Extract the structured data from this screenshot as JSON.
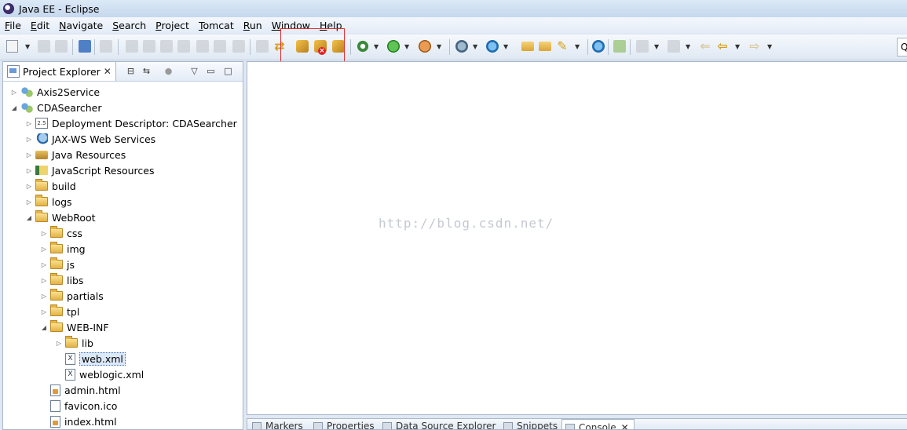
{
  "window": {
    "title": "Java EE - Eclipse"
  },
  "menu": [
    "File",
    "Edit",
    "Navigate",
    "Search",
    "Project",
    "Tomcat",
    "Run",
    "Window",
    "Help"
  ],
  "toolbar": {
    "highlighted_group": [
      "start-tomcat-icon",
      "stop-tomcat-icon",
      "restart-tomcat-icon"
    ],
    "quick_access_text": "Q"
  },
  "explorer": {
    "title": "Project Explorer",
    "close_glyph": "✕",
    "tree": [
      {
        "label": "Axis2Service",
        "depth": 0,
        "expander": "▷",
        "icon": "project"
      },
      {
        "label": "CDASearcher",
        "depth": 0,
        "expander": "◢",
        "icon": "project"
      },
      {
        "label": "Deployment Descriptor: CDASearcher",
        "depth": 1,
        "expander": "▷",
        "icon": "desc"
      },
      {
        "label": "JAX-WS Web Services",
        "depth": 1,
        "expander": "▷",
        "icon": "ws"
      },
      {
        "label": "Java Resources",
        "depth": 1,
        "expander": "▷",
        "icon": "jres"
      },
      {
        "label": "JavaScript Resources",
        "depth": 1,
        "expander": "▷",
        "icon": "jsres"
      },
      {
        "label": "build",
        "depth": 1,
        "expander": "▷",
        "icon": "folder"
      },
      {
        "label": "logs",
        "depth": 1,
        "expander": "▷",
        "icon": "folder"
      },
      {
        "label": "WebRoot",
        "depth": 1,
        "expander": "◢",
        "icon": "folder"
      },
      {
        "label": "css",
        "depth": 2,
        "expander": "▷",
        "icon": "folder"
      },
      {
        "label": "img",
        "depth": 2,
        "expander": "▷",
        "icon": "folder"
      },
      {
        "label": "js",
        "depth": 2,
        "expander": "▷",
        "icon": "folder"
      },
      {
        "label": "libs",
        "depth": 2,
        "expander": "▷",
        "icon": "folder"
      },
      {
        "label": "partials",
        "depth": 2,
        "expander": "▷",
        "icon": "folder"
      },
      {
        "label": "tpl",
        "depth": 2,
        "expander": "▷",
        "icon": "folder"
      },
      {
        "label": "WEB-INF",
        "depth": 2,
        "expander": "◢",
        "icon": "folder"
      },
      {
        "label": "lib",
        "depth": 3,
        "expander": "▷",
        "icon": "folder"
      },
      {
        "label": "web.xml",
        "depth": 3,
        "expander": "",
        "icon": "file",
        "selected": true
      },
      {
        "label": "weblogic.xml",
        "depth": 3,
        "expander": "",
        "icon": "file"
      },
      {
        "label": "admin.html",
        "depth": 2,
        "expander": "",
        "icon": "html"
      },
      {
        "label": "favicon.ico",
        "depth": 2,
        "expander": "",
        "icon": "blank"
      },
      {
        "label": "index.html",
        "depth": 2,
        "expander": "",
        "icon": "html"
      }
    ]
  },
  "editor": {
    "watermark": "http://blog.csdn.net/"
  },
  "bottom_tabs": [
    {
      "label": "Markers"
    },
    {
      "label": "Properties"
    },
    {
      "label": "Data Source Explorer"
    },
    {
      "label": "Snippets"
    },
    {
      "label": "Console",
      "active": true,
      "close": "✕"
    }
  ]
}
